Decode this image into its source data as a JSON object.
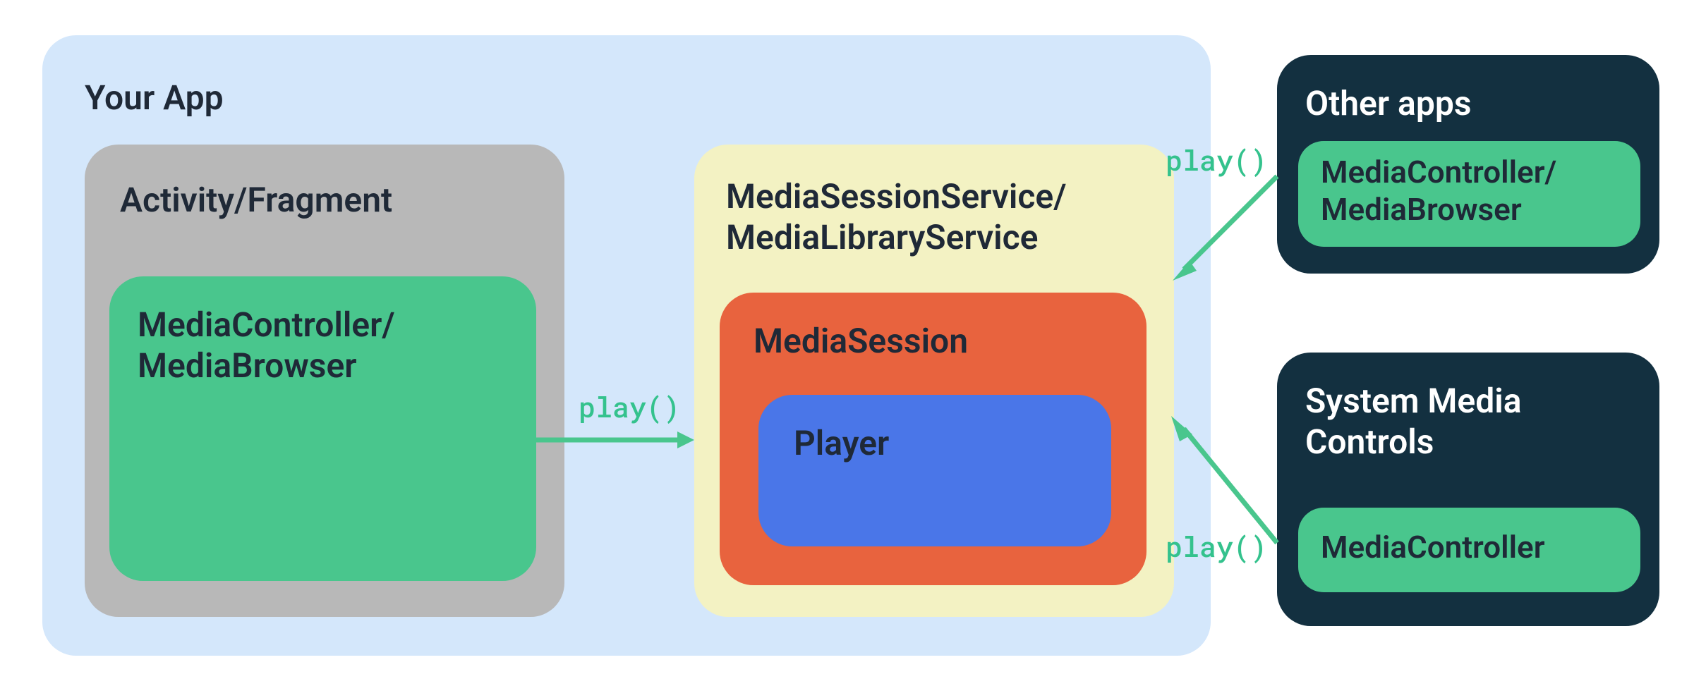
{
  "app": {
    "title": "Your App",
    "activity": {
      "title": "Activity/Fragment",
      "controller": "MediaController/\nMediaBrowser"
    },
    "service": {
      "title": "MediaSessionService/\nMediaLibraryService",
      "session": "MediaSession",
      "player": "Player"
    }
  },
  "other_apps": {
    "title": "Other apps",
    "controller": "MediaController/\nMediaBrowser"
  },
  "system_controls": {
    "title": "System Media\nControls",
    "controller": "MediaController"
  },
  "calls": {
    "from_activity": "play()",
    "from_other": "play()",
    "from_system": "play()"
  }
}
